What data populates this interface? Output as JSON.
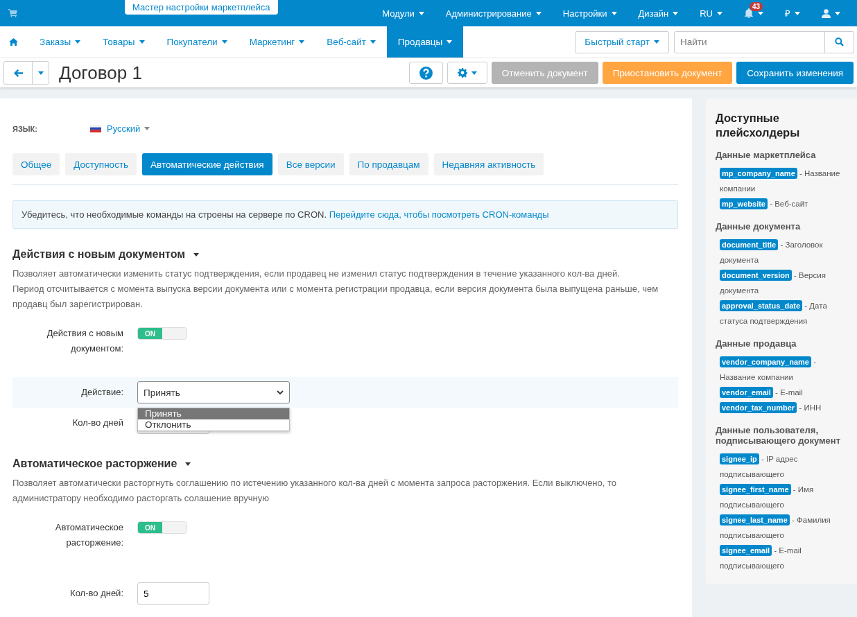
{
  "top_bar": {
    "wizard_button": "Мастер настройки маркетплейса",
    "menus": [
      {
        "label": "Модули"
      },
      {
        "label": "Администрирование"
      },
      {
        "label": "Настройки"
      },
      {
        "label": "Дизайн"
      },
      {
        "label": "RU"
      }
    ],
    "notifications": {
      "count": "43"
    },
    "currency": "₽"
  },
  "nav": {
    "items": [
      {
        "label": "Заказы",
        "selected": false
      },
      {
        "label": "Товары",
        "selected": false
      },
      {
        "label": "Покупатели",
        "selected": false
      },
      {
        "label": "Маркетинг",
        "selected": false
      },
      {
        "label": "Веб-сайт",
        "selected": false
      },
      {
        "label": "Продавцы",
        "selected": true
      }
    ],
    "quick_start": "Быстрый старт",
    "search": {
      "placeholder": "Найти"
    }
  },
  "toolbar": {
    "title": "Договор 1",
    "buttons": [
      {
        "label": "Отменить документ",
        "kind": "cancel"
      },
      {
        "label": "Приостановить документ",
        "kind": "suspend"
      },
      {
        "label": "Сохранить изменения",
        "kind": "save"
      }
    ]
  },
  "language": {
    "label": "ЯЗЫК:",
    "value": "Русский"
  },
  "tabs": [
    {
      "label": "Общее",
      "selected": false
    },
    {
      "label": "Доступность",
      "selected": false
    },
    {
      "label": "Автоматические действия",
      "selected": true
    },
    {
      "label": "Все версии",
      "selected": false
    },
    {
      "label": "По продавцам",
      "selected": false
    },
    {
      "label": "Недавняя активность",
      "selected": false
    }
  ],
  "notice": {
    "text": "Убедитесь, что необходимые команды на строены на сервере по CRON.",
    "link": "Перейдите сюда, чтобы посмотреть CRON-команды"
  },
  "sections": [
    {
      "title": "Действия с новым документом",
      "description": [
        "Позволяет автоматически изменить статус подтверждения, если продавец не изменил статус подтверждения в течение указанного кол-ва дней.",
        "Период отсчитывается с момента выпуска версии документа или с момента регистрации продавца, если версия документа была выпущена раньше, чем продавц был зарегистрирован."
      ],
      "fields": [
        {
          "kind": "switch",
          "label": "Действия с новым документом:",
          "on": true,
          "state_label": "ON"
        },
        {
          "kind": "select",
          "label": "Действие:",
          "value": "Принять",
          "highlighted": true,
          "expanded": true,
          "options": [
            {
              "label": "Принять",
              "selected": true
            },
            {
              "label": "Отклонить",
              "selected": false
            }
          ]
        },
        {
          "kind": "number",
          "label": "Кол-во дней"
        }
      ]
    },
    {
      "title": "Автоматическое расторжение",
      "description": [
        "Позволяет автоматически расторгнуть соглашению по истечению указанного кол-ва дней с момента запроса расторжения. Если выключено, то администратору необходимо расторгать солашение вручную"
      ],
      "fields": [
        {
          "kind": "switch",
          "label": "Автоматическое расторжение:",
          "on": true,
          "state_label": "ON"
        },
        {
          "kind": "number",
          "label": "Кол-во дней:",
          "value": "5"
        }
      ]
    }
  ],
  "sidebar": {
    "title": "Доступные плейсхолдеры",
    "groups": [
      {
        "title": "Данные маркетплейса",
        "items": [
          {
            "tag": "mp_company_name",
            "description": "- Название компании"
          },
          {
            "tag": "mp_website",
            "description": "- Веб-сайт"
          }
        ]
      },
      {
        "title": "Данные документа",
        "items": [
          {
            "tag": "document_title",
            "description": "- Заголовок документа"
          },
          {
            "tag": "document_version",
            "description": "- Версия документа"
          },
          {
            "tag": "approval_status_date",
            "description": "- Дата статуса подтверждения"
          }
        ]
      },
      {
        "title": "Данные продавца",
        "items": [
          {
            "tag": "vendor_company_name",
            "description": "- Название компании"
          },
          {
            "tag": "vendor_email",
            "description": "- E-mail"
          },
          {
            "tag": "vendor_tax_number",
            "description": "- ИНН"
          }
        ]
      },
      {
        "title": "Данные пользователя, подписывающего документ",
        "items": [
          {
            "tag": "signee_ip",
            "description": "- IP адрес подписывающего"
          },
          {
            "tag": "signee_first_name",
            "description": "- Имя подписывающего"
          },
          {
            "tag": "signee_last_name",
            "description": "- Фамилия подписывающего"
          },
          {
            "tag": "signee_email",
            "description": "- E-mail подписывающего"
          }
        ]
      }
    ]
  }
}
